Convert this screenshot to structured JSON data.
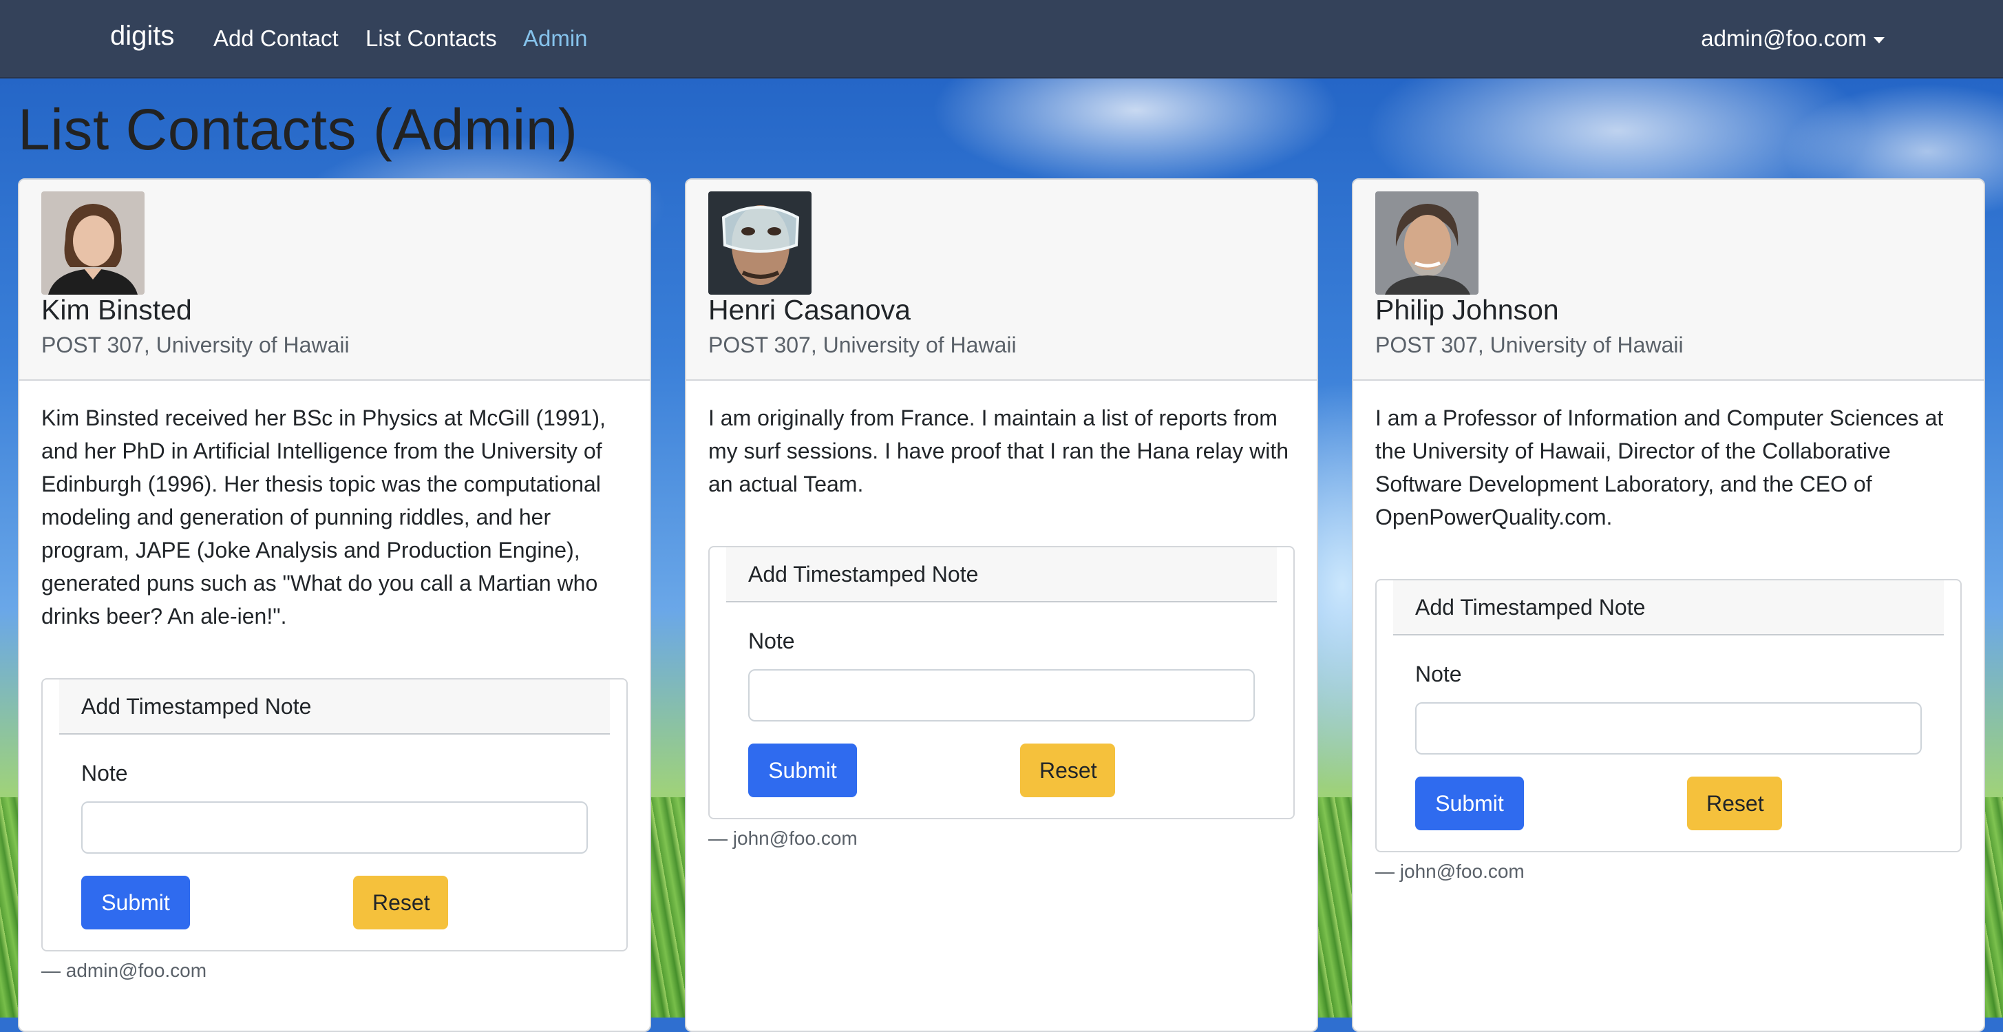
{
  "navbar": {
    "brand": "digits",
    "links": [
      "Add Contact",
      "List Contacts",
      "Admin"
    ],
    "user": "admin@foo.com"
  },
  "page_title": "List Contacts (Admin)",
  "cards": [
    {
      "name": "Kim Binsted",
      "address": "POST 307, University of Hawaii",
      "description": "Kim Binsted received her BSc in Physics at McGill (1991), and her PhD in Artificial Intelligence from the University of Edinburgh (1996). Her thesis topic was the computational modeling and generation of punning riddles, and her program, JAPE (Joke Analysis and Production Engine), generated puns such as \"What do you call a Martian who drinks beer? An ale-ien!\".",
      "note_form": {
        "title": "Add Timestamped Note",
        "label": "Note",
        "value": "",
        "submit": "Submit",
        "reset": "Reset"
      },
      "owner": "— admin@foo.com"
    },
    {
      "name": "Henri Casanova",
      "address": "POST 307, University of Hawaii",
      "description": "I am originally from France. I maintain a list of reports from my surf sessions. I have proof that I ran the Hana relay with an actual Team.",
      "note_form": {
        "title": "Add Timestamped Note",
        "label": "Note",
        "value": "",
        "submit": "Submit",
        "reset": "Reset"
      },
      "owner": "— john@foo.com"
    },
    {
      "name": "Philip Johnson",
      "address": "POST 307, University of Hawaii",
      "description": "I am a Professor of Information and Computer Sciences at the University of Hawaii, Director of the Collaborative Software Development Laboratory, and the CEO of OpenPowerQuality.com.",
      "note_form": {
        "title": "Add Timestamped Note",
        "label": "Note",
        "value": "",
        "submit": "Submit",
        "reset": "Reset"
      },
      "owner": "— john@foo.com"
    }
  ]
}
